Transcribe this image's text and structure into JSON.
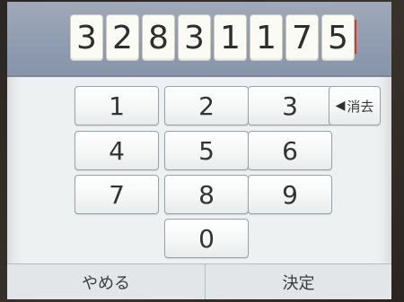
{
  "display": {
    "digits": [
      "3",
      "2",
      "8",
      "3",
      "1",
      "1",
      "7",
      "5"
    ]
  },
  "keypad": {
    "keys": [
      "1",
      "2",
      "3",
      "4",
      "5",
      "6",
      "7",
      "8",
      "9",
      "0"
    ],
    "backspace_label": "消去",
    "backspace_icon": "arrow-left-icon"
  },
  "bottom": {
    "cancel_label": "やめる",
    "confirm_label": "決定"
  },
  "colors": {
    "display_bar": "#8f9bb0",
    "screen_bg": "#eef1f2",
    "cursor": "#d43a2b"
  }
}
